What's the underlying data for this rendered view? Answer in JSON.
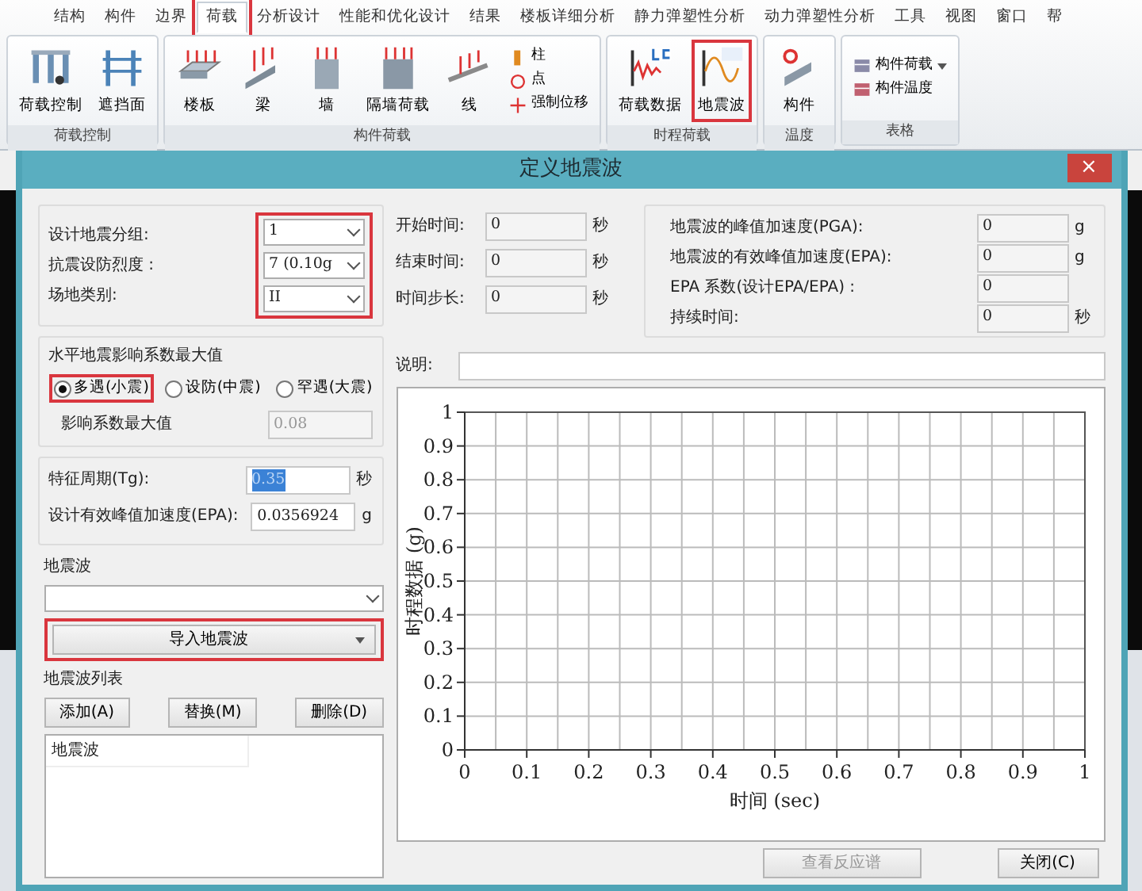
{
  "ribbon": {
    "tabs": [
      {
        "label": "结构",
        "selected": false,
        "highlighted": false
      },
      {
        "label": "构件",
        "selected": false,
        "highlighted": false
      },
      {
        "label": "边界",
        "selected": false,
        "highlighted": false
      },
      {
        "label": "荷载",
        "selected": true,
        "highlighted": true
      },
      {
        "label": "分析设计",
        "selected": false,
        "highlighted": false
      },
      {
        "label": "性能和优化设计",
        "selected": false,
        "highlighted": false
      },
      {
        "label": "结果",
        "selected": false,
        "highlighted": false
      },
      {
        "label": "楼板详细分析",
        "selected": false,
        "highlighted": false
      },
      {
        "label": "静力弹塑性分析",
        "selected": false,
        "highlighted": false
      },
      {
        "label": "动力弹塑性分析",
        "selected": false,
        "highlighted": false
      },
      {
        "label": "工具",
        "selected": false,
        "highlighted": false
      },
      {
        "label": "视图",
        "selected": false,
        "highlighted": false
      },
      {
        "label": "窗口",
        "selected": false,
        "highlighted": false
      },
      {
        "label": "帮",
        "selected": false,
        "highlighted": false
      }
    ],
    "groups": [
      {
        "title": "荷载控制",
        "buttons": [
          {
            "label": "荷载控制",
            "kind": "large",
            "highlighted": false
          },
          {
            "label": "遮挡面",
            "kind": "large",
            "highlighted": false
          }
        ]
      },
      {
        "title": "构件荷载",
        "buttons": [
          {
            "label": "楼板",
            "kind": "large",
            "highlighted": false
          },
          {
            "label": "梁",
            "kind": "large",
            "highlighted": false
          },
          {
            "label": "墙",
            "kind": "large",
            "highlighted": false
          },
          {
            "label": "隔墙荷载",
            "kind": "large",
            "highlighted": false
          },
          {
            "label": "线",
            "kind": "large",
            "highlighted": false
          },
          {
            "label": "柱",
            "kind": "small",
            "highlighted": false
          },
          {
            "label": "点",
            "kind": "small",
            "highlighted": false
          },
          {
            "label": "强制位移",
            "kind": "small",
            "highlighted": false
          }
        ]
      },
      {
        "title": "时程荷载",
        "buttons": [
          {
            "label": "荷载数据",
            "kind": "large",
            "highlighted": false
          },
          {
            "label": "地震波",
            "kind": "large",
            "highlighted": true
          }
        ]
      },
      {
        "title": "温度",
        "buttons": [
          {
            "label": "构件",
            "kind": "large",
            "highlighted": false
          }
        ]
      },
      {
        "title": "表格",
        "buttons": [
          {
            "label": "构件荷载",
            "kind": "small",
            "highlighted": false,
            "has_menu": true
          },
          {
            "label": "构件温度",
            "kind": "small",
            "highlighted": false,
            "has_menu": false
          }
        ]
      }
    ]
  },
  "dialog": {
    "title": "定义地震波",
    "close": "×",
    "site_params": {
      "highlighted": true,
      "rows": [
        {
          "label": "设计地震分组:",
          "value": "1"
        },
        {
          "label": "抗震设防烈度 :",
          "value": "7 (0.10g"
        },
        {
          "label": "场地类别:",
          "value": "II"
        }
      ]
    },
    "coefficient": {
      "title": "水平地震影响系数最大值",
      "options": [
        {
          "label": "多遇(小震)",
          "selected": true,
          "highlighted": true
        },
        {
          "label": "设防(中震)",
          "selected": false,
          "highlighted": false
        },
        {
          "label": "罕遇(大震)",
          "selected": false,
          "highlighted": false
        }
      ],
      "max_label": "影响系数最大值",
      "max_value": "0.08",
      "max_disabled": true
    },
    "period": [
      {
        "label": "特征周期(Tg):",
        "value": "0.35",
        "unit": "秒",
        "selected": true
      },
      {
        "label": "设计有效峰值加速度(EPA):",
        "value": "0.0356924",
        "unit": "g",
        "selected": false
      }
    ],
    "wave_label": "地震波",
    "import_button": {
      "label": "导入地震波",
      "highlighted": true
    },
    "list_label": "地震波列表",
    "list_buttons": [
      "添加(A)",
      "替换(M)",
      "删除(D)"
    ],
    "list_header": "地震波",
    "time_fields": [
      {
        "label": "开始时间:",
        "value": "0",
        "unit": "秒"
      },
      {
        "label": "结束时间:",
        "value": "0",
        "unit": "秒"
      },
      {
        "label": "时间步长:",
        "value": "0",
        "unit": "秒"
      }
    ],
    "stats": [
      {
        "label": "地震波的峰值加速度(PGA):",
        "value": "0",
        "unit": "g"
      },
      {
        "label": "地震波的有效峰值加速度(EPA):",
        "value": "0",
        "unit": "g"
      },
      {
        "label": "EPA 系数(设计EPA/EPA) :",
        "value": "0"
      },
      {
        "label": "持续时间:",
        "value": "0",
        "unit": "秒"
      }
    ],
    "note_label": "说明:",
    "chart_data": {
      "type": "line",
      "grid": true,
      "xlabel": "时间 (sec)",
      "ylabel": "时程数据 (g)",
      "xlim": [
        0,
        1
      ],
      "ylim": [
        0,
        1
      ],
      "xticks": [
        0,
        {
          "value": 0.1,
          "label": "0.1"
        },
        {
          "value": 0.2,
          "label": "0.2"
        },
        {
          "value": 0.3,
          "label": "0.3"
        },
        {
          "value": 0.4,
          "label": "0.4"
        },
        {
          "value": 0.5,
          "label": "0.5"
        },
        {
          "value": 0.6,
          "label": "0.6"
        },
        {
          "value": 0.7,
          "label": "0.7"
        },
        {
          "value": 0.8,
          "label": "0.8"
        },
        {
          "value": 0.9,
          "label": "0.9"
        },
        1
      ],
      "yticks": [
        0,
        {
          "value": 0.1,
          "label": "0.1"
        },
        {
          "value": 0.2,
          "label": "0.2"
        },
        {
          "value": 0.3,
          "label": "0.3"
        },
        {
          "value": 0.4,
          "label": "0.4"
        },
        {
          "value": 0.5,
          "label": "0.5"
        },
        {
          "value": 0.6,
          "label": "0.6"
        },
        {
          "value": 0.7,
          "label": "0.7"
        },
        {
          "value": 0.8,
          "label": "0.8"
        },
        {
          "value": 0.9,
          "label": "0.9"
        },
        1
      ]
    },
    "buttons": [
      {
        "label": "查看反应谱",
        "disabled": true
      },
      {
        "label": "关闭(C)",
        "disabled": false
      }
    ]
  }
}
